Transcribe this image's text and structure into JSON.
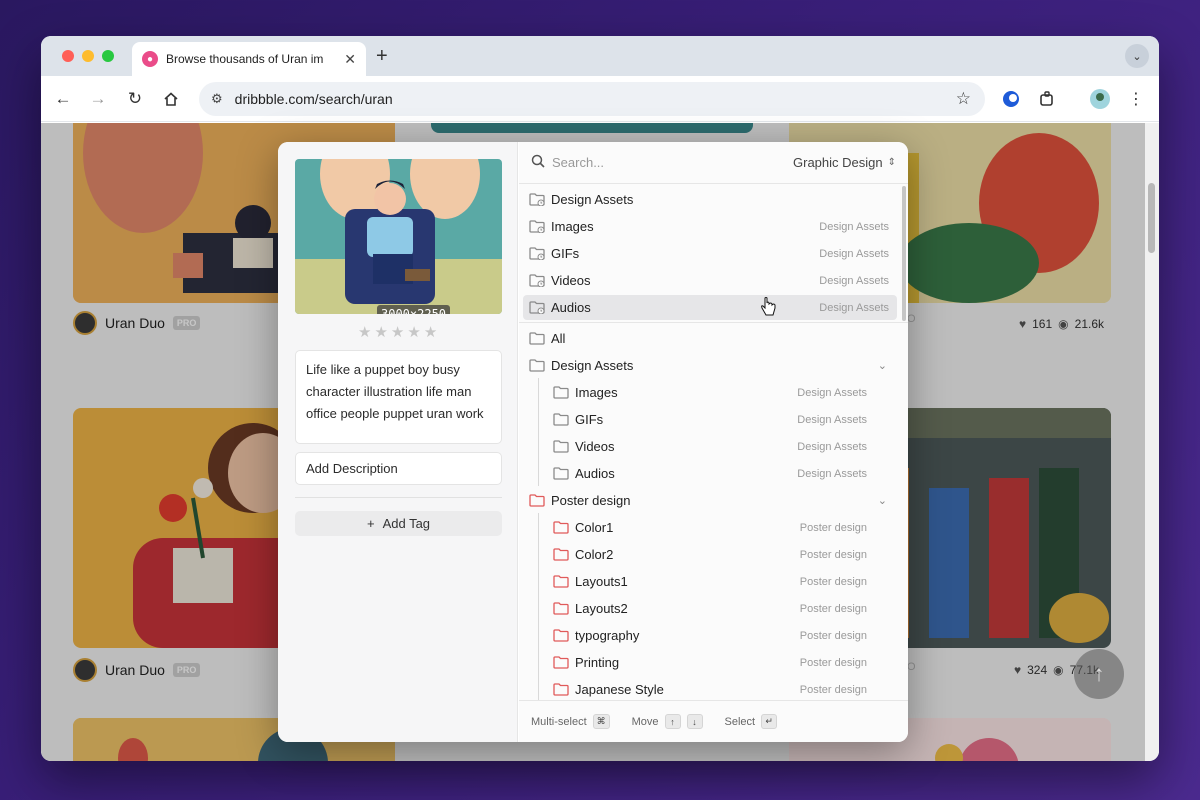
{
  "browser": {
    "tab_title": "Browse thousands of Uran im",
    "url": "dribbble.com/search/uran"
  },
  "feed": {
    "author": "Uran Duo",
    "pro_badge": "PRO",
    "card1_stats": {
      "likes": "161",
      "views": "21.6k"
    },
    "card2_stats": {
      "likes": "324",
      "views": "77.1k"
    },
    "stub_pro_1": "O",
    "stub_pro_2": "O"
  },
  "dialog": {
    "dimensions": "3000×2250",
    "rating": 0,
    "rating_max": 5,
    "note": "Life like a puppet boy busy character illustration life man office people puppet uran work",
    "description_placeholder": "Add Description",
    "add_tag": "Add Tag",
    "search_placeholder": "Search...",
    "scope": "Graphic Design",
    "recent": [
      {
        "label": "Design Assets",
        "path": ""
      },
      {
        "label": "Images",
        "path": "Design Assets"
      },
      {
        "label": "GIFs",
        "path": "Design Assets"
      },
      {
        "label": "Videos",
        "path": "Design Assets"
      },
      {
        "label": "Audios",
        "path": "Design Assets"
      }
    ],
    "tree": [
      {
        "label": "All",
        "path": ""
      },
      {
        "label": "Design Assets",
        "path": ""
      },
      {
        "label": "Images",
        "path": "Design Assets"
      },
      {
        "label": "GIFs",
        "path": "Design Assets"
      },
      {
        "label": "Videos",
        "path": "Design Assets"
      },
      {
        "label": "Audios",
        "path": "Design Assets"
      },
      {
        "label": "Poster design",
        "path": ""
      },
      {
        "label": "Color1",
        "path": "Poster design"
      },
      {
        "label": "Color2",
        "path": "Poster design"
      },
      {
        "label": "Layouts1",
        "path": "Poster design"
      },
      {
        "label": "Layouts2",
        "path": "Poster design"
      },
      {
        "label": "typography",
        "path": "Poster design"
      },
      {
        "label": "Printing",
        "path": "Poster design"
      },
      {
        "label": "Japanese Style",
        "path": "Poster design"
      }
    ],
    "footer": {
      "multi": "Multi-select",
      "multi_key": "⌘",
      "move": "Move",
      "move_up": "↑",
      "move_down": "↓",
      "select": "Select",
      "select_key": "↵"
    }
  },
  "colors": {
    "folder_gray": "#8a8a8a",
    "folder_red": "#e05a5a",
    "highlight": "#e6e6e8"
  }
}
